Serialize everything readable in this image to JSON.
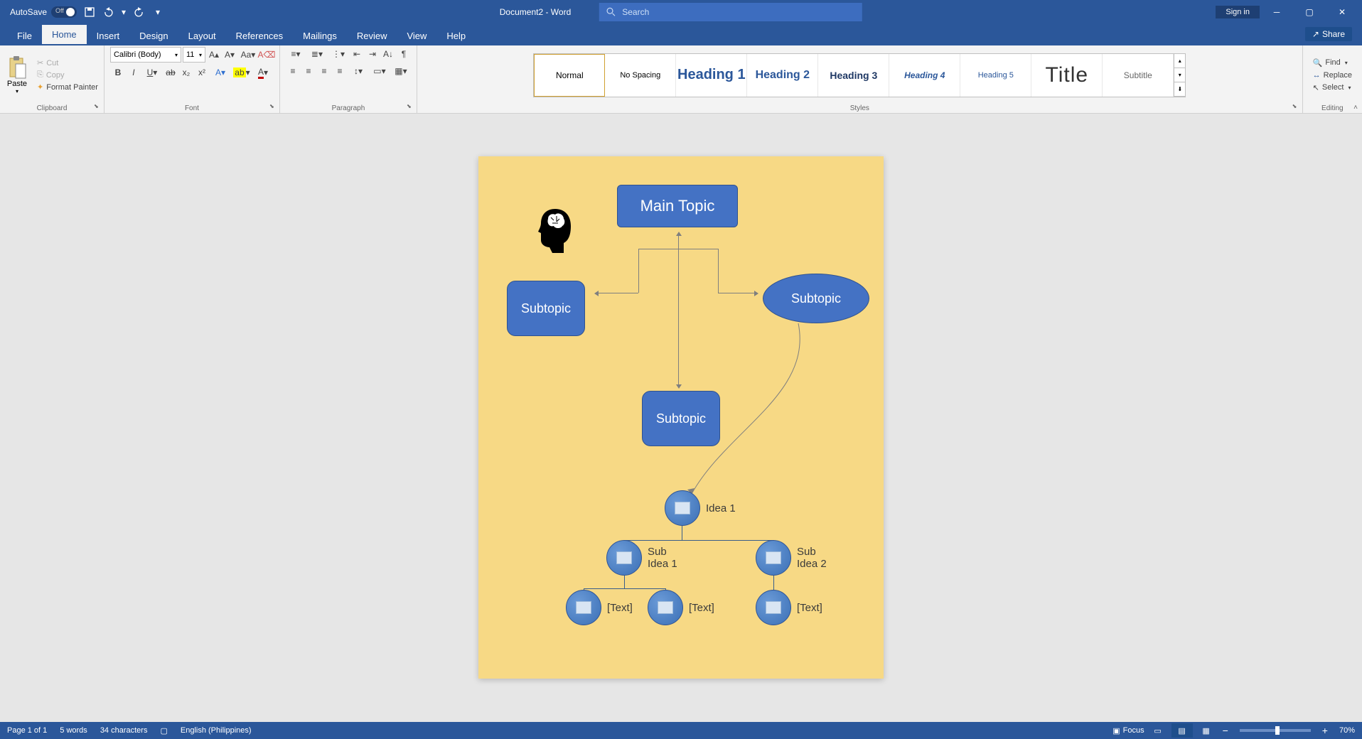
{
  "titlebar": {
    "autosave_label": "AutoSave",
    "autosave_state": "Off",
    "doc_title": "Document2  -  Word",
    "search_placeholder": "Search",
    "signin": "Sign in"
  },
  "tabs": {
    "file": "File",
    "home": "Home",
    "insert": "Insert",
    "design": "Design",
    "layout": "Layout",
    "references": "References",
    "mailings": "Mailings",
    "review": "Review",
    "view": "View",
    "help": "Help",
    "share": "Share"
  },
  "ribbon": {
    "clipboard": {
      "label": "Clipboard",
      "paste": "Paste",
      "cut": "Cut",
      "copy": "Copy",
      "format_painter": "Format Painter"
    },
    "font": {
      "label": "Font",
      "name": "Calibri (Body)",
      "size": "11"
    },
    "paragraph": {
      "label": "Paragraph"
    },
    "styles": {
      "label": "Styles",
      "normal": "Normal",
      "no_spacing": "No Spacing",
      "heading1": "Heading 1",
      "heading2": "Heading 2",
      "heading3": "Heading 3",
      "heading4": "Heading 4",
      "heading5": "Heading 5",
      "title": "Title",
      "subtitle": "Subtitle"
    },
    "editing": {
      "label": "Editing",
      "find": "Find",
      "replace": "Replace",
      "select": "Select"
    }
  },
  "document": {
    "main_topic": "Main Topic",
    "subtopic_left": "Subtopic",
    "subtopic_right": "Subtopic",
    "subtopic_mid": "Subtopic",
    "smartart": {
      "idea1": "Idea 1",
      "sub1": "Sub Idea 1",
      "sub2": "Sub Idea 2",
      "text1": "[Text]",
      "text2": "[Text]",
      "text3": "[Text]"
    }
  },
  "statusbar": {
    "page": "Page 1 of 1",
    "words": "5 words",
    "chars": "34 characters",
    "language": "English (Philippines)",
    "focus": "Focus",
    "zoom": "70%"
  }
}
